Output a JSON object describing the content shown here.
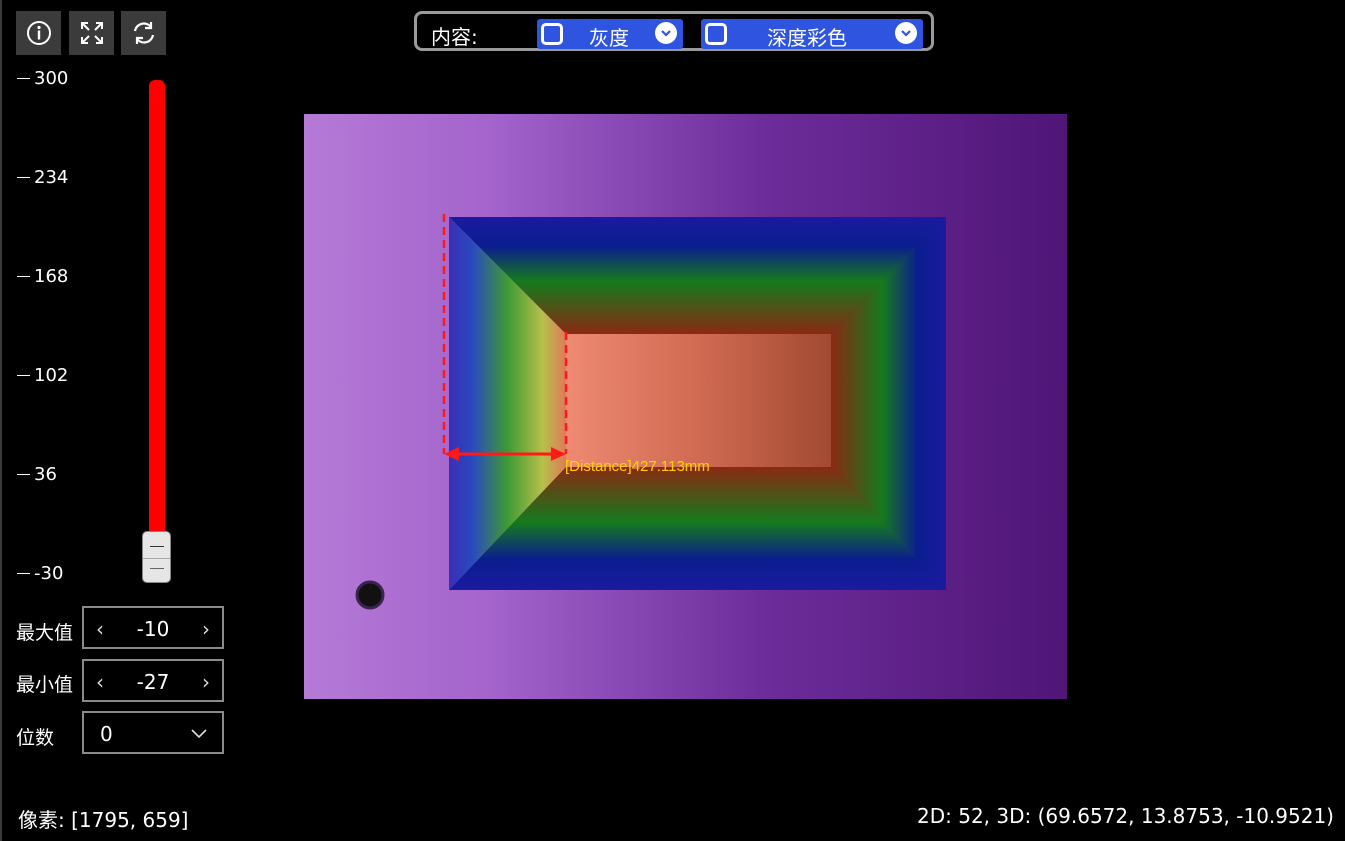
{
  "toolbar": {
    "info_icon": "info-icon",
    "fullscreen_icon": "expand-icon",
    "refresh_icon": "refresh-icon"
  },
  "content_selector": {
    "label": "内容:",
    "option1": {
      "label": "灰度",
      "checked": false
    },
    "option2": {
      "label": "深度彩色",
      "checked": false
    }
  },
  "scale": {
    "ticks": [
      "300",
      "234",
      "168",
      "102",
      "36",
      "-30"
    ]
  },
  "range_controls": {
    "max_label": "最大值",
    "max_value": "-10",
    "min_label": "最小值",
    "min_value": "-27",
    "digits_label": "位数",
    "digits_value": "0"
  },
  "measurement": {
    "label": "[Distance]427.113mm"
  },
  "status": {
    "pixel": "像素: [1795, 659]",
    "coords": "2D: 52, 3D: (69.6572, 13.8753, -10.9521)"
  },
  "colors": {
    "accent": "#2f55e0",
    "slider": "#ff0000",
    "measure": "#ff1a1a",
    "measure_text": "#ffd200"
  }
}
